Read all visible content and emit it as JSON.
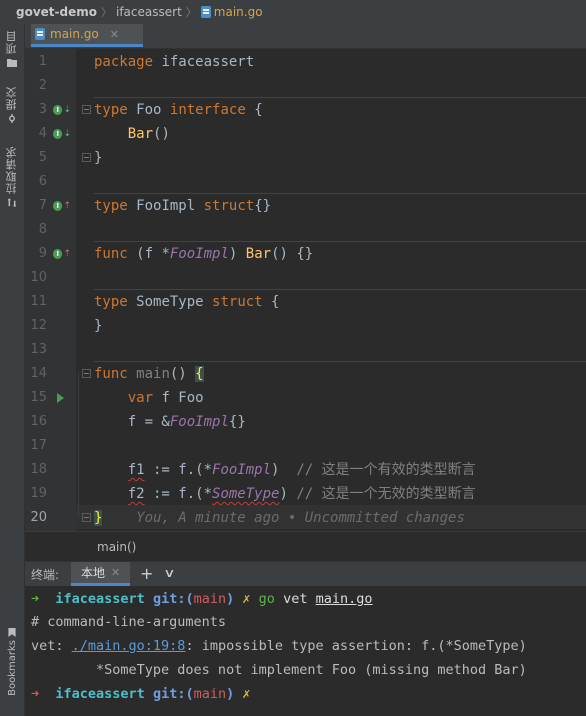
{
  "breadcrumb": {
    "project": "govet-demo",
    "package": "ifaceassert",
    "file": "main.go"
  },
  "left_tools": {
    "project": "项目",
    "commit": "提交",
    "pull_requests": "拉取请求",
    "bookmarks": "Bookmarks"
  },
  "editor": {
    "tab_label": "main.go",
    "current_line": 20,
    "line_numbers": [
      "1",
      "2",
      "3",
      "4",
      "5",
      "6",
      "7",
      "8",
      "9",
      "10",
      "11",
      "12",
      "13",
      "14",
      "15",
      "16",
      "17",
      "18",
      "19",
      "20"
    ],
    "lines": {
      "l1_kw": "package",
      "l1_name": "ifaceassert",
      "l3_kw": "type",
      "l3_name": "Foo",
      "l3_kw2": "interface",
      "l3_brace": "{",
      "l4_method": "Bar",
      "l4_paren": "()",
      "l5_brace": "}",
      "l7_kw": "type",
      "l7_name": "FooImpl",
      "l7_kw2": "struct",
      "l7_brace": "{}",
      "l9_kw": "func",
      "l9_p1": "(",
      "l9_recv": "f",
      "l9_star": " *",
      "l9_type": "FooImpl",
      "l9_p2": ") ",
      "l9_fn": "Bar",
      "l9_tail": "() {}",
      "l11_kw": "type",
      "l11_name": "SomeType",
      "l11_kw2": "struct",
      "l11_brace": "{",
      "l12_brace": "}",
      "l14_kw": "func",
      "l14_fn": "main",
      "l14_paren": "() ",
      "l14_brace": "{",
      "l15_kw": "var",
      "l15_rest": " f Foo",
      "l16_a": "f = &",
      "l16_type": "FooImpl",
      "l16_b": "{}",
      "l18_var": "f1",
      "l18_a": " := f.(*",
      "l18_type": "FooImpl",
      "l18_b": ")  ",
      "l18_cm": "// 这是一个有效的类型断言",
      "l19_var": "f2",
      "l19_a": " := f.(*",
      "l19_type": "SomeType",
      "l19_b": ") ",
      "l19_cm": "// 这是一个无效的类型断言",
      "l20_brace": "}",
      "l20_blame": "You, A minute ago • Uncommitted changes"
    },
    "code_breadcrumb": "main()"
  },
  "terminal": {
    "title": "终端:",
    "tab_label": "本地",
    "add_label": "+",
    "more_label": "∨",
    "prompt1": {
      "arrow": "➜",
      "dir": "ifaceassert",
      "git": "git:(",
      "branch": "main",
      "git_close": ")",
      "dirty": "✗",
      "cmd": "go",
      "args": "vet",
      "file": "main.go"
    },
    "out1": "# command-line-arguments",
    "out2_prefix": "vet: ",
    "out2_link": "./main.go:19:8",
    "out2_msg": ": impossible type assertion: f.(*SomeType)",
    "out3": "        *SomeType does not implement Foo (missing method Bar)",
    "prompt2": {
      "arrow": "➜",
      "dir": "ifaceassert",
      "git": "git:(",
      "branch": "main",
      "git_close": ")",
      "dirty": "✗"
    }
  },
  "colors": {
    "background": "#2b2b2b",
    "keyword": "#cc7832",
    "function": "#ffc66d",
    "type_italic": "#9876aa",
    "accent_tab": "#4a88c7"
  }
}
